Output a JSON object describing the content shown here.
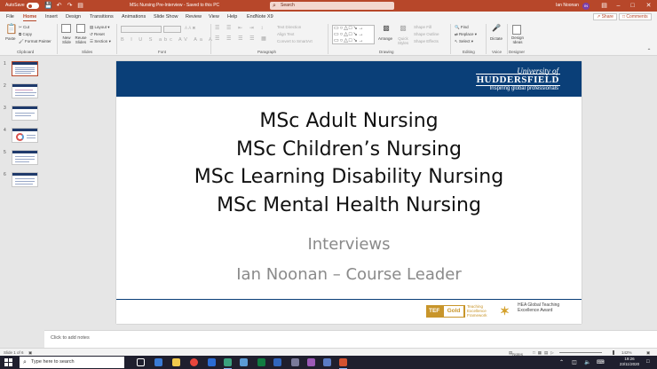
{
  "titlebar": {
    "autosave_label": "AutoSave",
    "autosave_state": "Off",
    "document_title": "MSc Nursing Pre-Interview  -  Saved to this PC",
    "search_placeholder": "Search",
    "user_name": "Ian Noonan",
    "avatar_initials": "IN",
    "accent_color": "#b7472a"
  },
  "menu_tabs": [
    "File",
    "Home",
    "Insert",
    "Design",
    "Transitions",
    "Animations",
    "Slide Show",
    "Review",
    "View",
    "Help",
    "EndNote X9"
  ],
  "active_tab": "Home",
  "share_label": "Share",
  "comments_label": "Comments",
  "ribbon": {
    "clipboard": {
      "paste": "Paste",
      "cut": "Cut",
      "copy": "Copy",
      "format_painter": "Format Painter",
      "label": "Clipboard"
    },
    "slides": {
      "new_slide": "New Slide",
      "reuse": "Reuse Slides",
      "layout": "Layout",
      "reset": "Reset",
      "section": "Section",
      "label": "Slides"
    },
    "font": {
      "label": "Font"
    },
    "paragraph": {
      "text_direction": "Text Direction",
      "align_text": "Align Text",
      "convert_smartart": "Convert to SmartArt",
      "label": "Paragraph"
    },
    "drawing": {
      "arrange": "Arrange",
      "quick_styles": "Quick Styles",
      "shape_fill": "Shape Fill",
      "shape_outline": "Shape Outline",
      "shape_effects": "Shape Effects",
      "label": "Drawing"
    },
    "editing": {
      "find": "Find",
      "replace": "Replace",
      "select": "Select",
      "label": "Editing"
    },
    "voice": {
      "dictate": "Dictate",
      "label": "Voice"
    },
    "designer": {
      "design_ideas": "Design Ideas",
      "label": "Designer"
    }
  },
  "thumbnails": [
    "1",
    "2",
    "3",
    "4",
    "5",
    "6"
  ],
  "slide": {
    "uni_top": "University of",
    "uni_name": "HUDDERSFIELD",
    "uni_tagline": "Inspiring global professionals",
    "programmes": [
      "MSc Adult Nursing",
      "MSc Children’s Nursing",
      "MSc Learning Disability Nursing",
      "MSc Mental Health Nursing"
    ],
    "subtitle": "Interviews",
    "presenter": "Ian Noonan – Course Leader",
    "tef_badge": "TEF",
    "tef_level": "Gold",
    "tef_text": "Teaching Excellence Framework",
    "hea_text": "HEA Global Teaching Excellence Award",
    "header_color": "#0a3f78"
  },
  "notes_placeholder": "Click to add notes",
  "status": {
    "slide_counter": "Slide 1 of 6",
    "notes": "Notes",
    "zoom": "142%"
  },
  "taskbar": {
    "search_placeholder": "Type here to search",
    "time": "19:26",
    "date": "23/11/2020"
  }
}
